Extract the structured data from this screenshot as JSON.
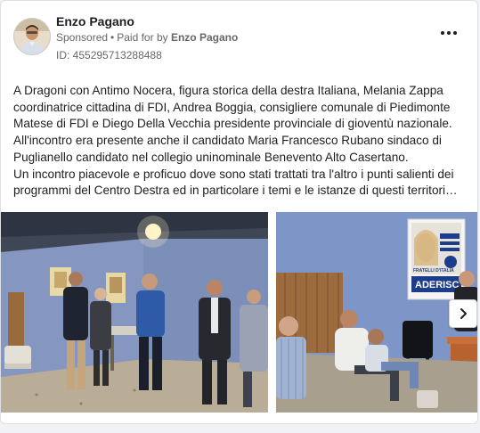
{
  "post": {
    "author": "Enzo Pagano",
    "sponsored": "Sponsored",
    "separator": "•",
    "paid_for_prefix": "Paid for by",
    "paid_for_name": "Enzo Pagano",
    "ad_id": "ID: 455295713288488",
    "more_icon": "more-horizontal-icon",
    "text_lines": [
      "A Dragoni con Antimo Nocera, figura storica della destra Italiana, Melania Zappa",
      "coordinatrice cittadina di FDI, Andrea Boggia, consigliere comunale di Piedimonte",
      "Matese di FDI e Diego Della Vecchia presidente provinciale di gioventù nazionale.",
      "All'incontro era presente anche il candidato Maria Francesco Rubano sindaco di",
      "Puglianello candidato nel collegio uninominale Benevento Alto Casertano.",
      "Un incontro piacevole e proficuo dove sono stati trattati tra l'altro i punti salienti dei",
      "programmi del Centro Destra ed in particolare i temi e le istanze di questi territori…"
    ]
  },
  "gallery": {
    "poster_text": "ADERISC",
    "poster_subtext": "FRATELLI D'ITALIA",
    "next_icon": "chevron-right-icon"
  },
  "colors": {
    "card_bg": "#ffffff",
    "page_bg": "#f0f2f5",
    "text": "#1c1e21",
    "secondary": "#65676b"
  }
}
